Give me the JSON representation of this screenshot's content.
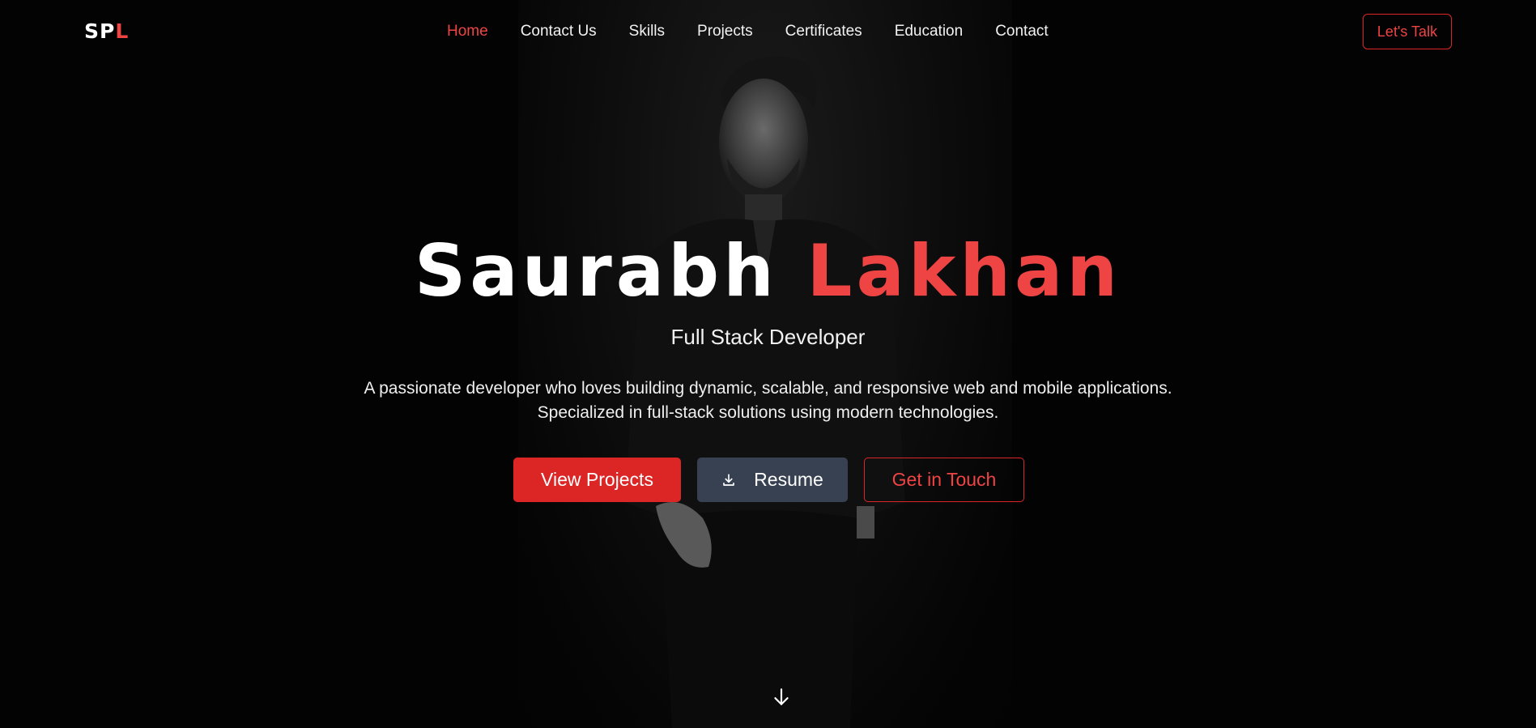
{
  "brand": {
    "logo_part1": "SP",
    "logo_part2": "L"
  },
  "nav": {
    "items": [
      {
        "label": "Home",
        "active": true
      },
      {
        "label": "Contact Us",
        "active": false
      },
      {
        "label": "Skills",
        "active": false
      },
      {
        "label": "Projects",
        "active": false
      },
      {
        "label": "Certificates",
        "active": false
      },
      {
        "label": "Education",
        "active": false
      },
      {
        "label": "Contact",
        "active": false
      }
    ],
    "cta_label": "Let's Talk"
  },
  "hero": {
    "first_name": "Saurabh",
    "last_name": "Lakhan",
    "role": "Full Stack Developer",
    "description": "A passionate developer who loves building dynamic, scalable, and responsive web and mobile applications. Specialized in full-stack solutions using modern technologies.",
    "buttons": {
      "view_projects": "View Projects",
      "resume": "Resume",
      "get_in_touch": "Get in Touch"
    }
  },
  "icons": {
    "resume": "download-icon",
    "scroll": "arrow-down-icon"
  },
  "colors": {
    "accent": "#ef4444",
    "accent_dark": "#dc2626",
    "background": "#030303",
    "resume_button": "#374151"
  }
}
